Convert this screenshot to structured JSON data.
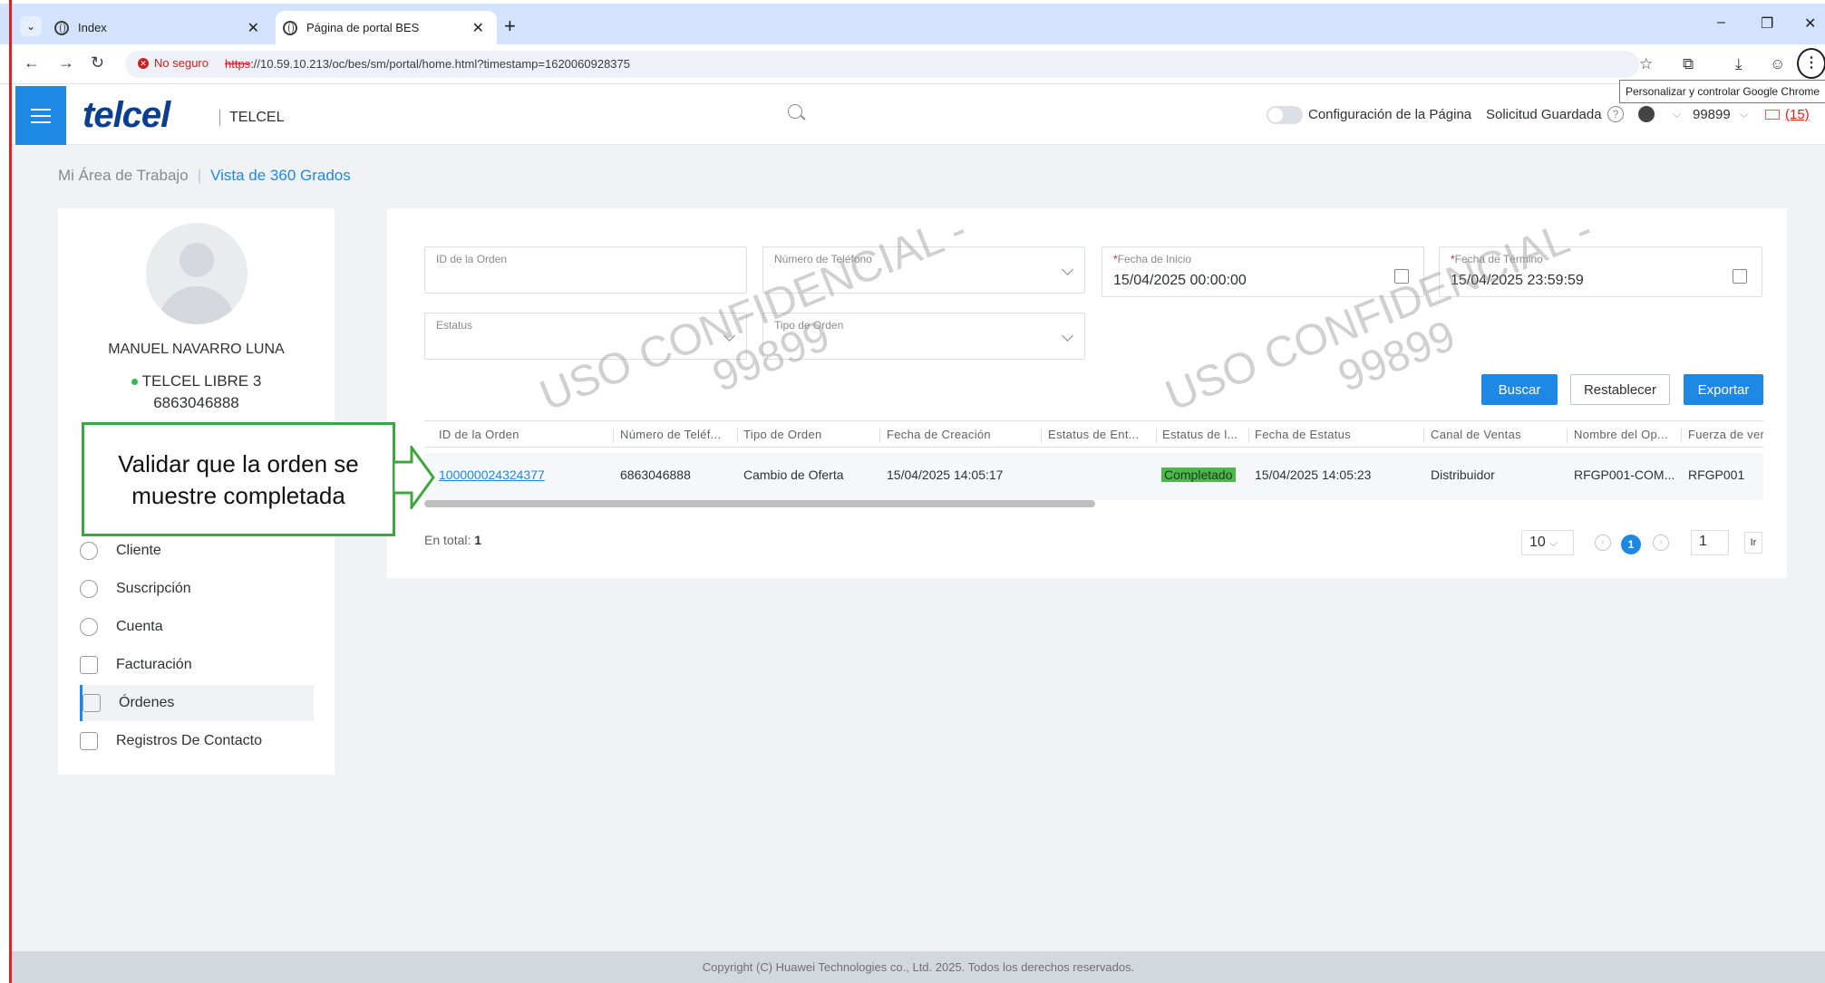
{
  "browser": {
    "tabs": [
      {
        "title": "Index",
        "active": false
      },
      {
        "title": "Página de portal BES",
        "active": true
      }
    ],
    "not_secure": "No seguro",
    "url_scheme": "https",
    "url_rest": "://10.59.10.213/oc/bes/sm/portal/home.html?timestamp=1620060928375",
    "tooltip": "Personalizar y controlar Google Chrome"
  },
  "header": {
    "logo": "telcel",
    "brand": "TELCEL",
    "page_config": "Configuración de la Página",
    "saved_request": "Solicitud Guardada",
    "user_code": "99899",
    "messages": "(15)",
    "accent": "#1e88e5"
  },
  "breadcrumb": {
    "workspace": "Mi Área de Trabajo",
    "current": "Vista de 360 Grados"
  },
  "customer": {
    "name": "MANUEL NAVARRO LUNA",
    "plan": "TELCEL LIBRE 3",
    "phone": "6863046888",
    "status_color": "#2ebf4f"
  },
  "menu": [
    {
      "label": "Cliente",
      "icon": "user-icon"
    },
    {
      "label": "Suscripción",
      "icon": "users-icon"
    },
    {
      "label": "Cuenta",
      "icon": "account-icon"
    },
    {
      "label": "Facturación",
      "icon": "invoice-icon"
    },
    {
      "label": "Órdenes",
      "icon": "orders-icon",
      "active": true
    },
    {
      "label": "Registros De Contacto",
      "icon": "contact-log-icon"
    }
  ],
  "callout": {
    "text_line1": "Validar que la orden se",
    "text_line2": "muestre completada"
  },
  "filters": {
    "order_id": {
      "label": "ID de la Orden",
      "value": ""
    },
    "phone_number": {
      "label": "Número de Teléfono",
      "value": ""
    },
    "start_date": {
      "label": "Fecha de Inicio",
      "value": "15/04/2025 00:00:00"
    },
    "end_date": {
      "label": "Fecha de Término",
      "value": "15/04/2025 23:59:59"
    },
    "status": {
      "label": "Estatus",
      "value": ""
    },
    "order_type": {
      "label": "Tipo de Orden",
      "value": ""
    }
  },
  "buttons": {
    "search": "Buscar",
    "reset": "Restablecer",
    "export": "Exportar"
  },
  "table": {
    "columns": [
      "ID de la Orden",
      "Número de Teléf...",
      "Tipo de Orden",
      "Fecha de Creación",
      "Estatus de Ent...",
      "Estatus de l...",
      "Fecha de Estatus",
      "Canal de Ventas",
      "Nombre del Op...",
      "Fuerza de venta"
    ],
    "rows": [
      {
        "order_id": "100000024324377",
        "phone": "6863046888",
        "order_type": "Cambio de Oferta",
        "created": "15/04/2025 14:05:17",
        "delivery_status": "",
        "status": "Completado",
        "status_date": "15/04/2025 14:05:23",
        "channel": "Distribuidor",
        "operator": "RFGP001-COM...",
        "sales_force": "RFGP001"
      }
    ]
  },
  "pagination": {
    "total_label": "En total:",
    "total": "1",
    "page_size": "10",
    "current_page": "1",
    "goto_page": "1",
    "go": "Ir"
  },
  "watermarks": [
    {
      "line1": "USO CONFIDENCIAL -",
      "line2": "99899"
    },
    {
      "line1": "USO CONFIDENCIAL -",
      "line2": "99899"
    }
  ],
  "footer": "Copyright (C) Huawei Technologies co., Ltd. 2025. Todos los derechos reservados."
}
